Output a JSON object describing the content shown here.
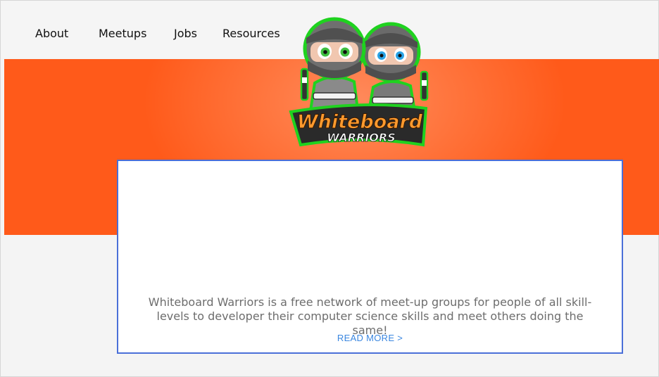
{
  "nav": {
    "items": [
      {
        "label": "About"
      },
      {
        "label": "Meetups"
      },
      {
        "label": "Jobs"
      },
      {
        "label": "Resources"
      }
    ]
  },
  "logo": {
    "line1": "Whiteboard",
    "line2": "WARRIORS",
    "colors": {
      "outline": "#1fd21f",
      "line1_fill": "#ff9a2e",
      "line2_fill": "#ffffff",
      "ninja_body": "#8a8a8a",
      "ninja_dark": "#5b5b5b"
    }
  },
  "hero": {
    "colors": {
      "edge": "#ff5a1a",
      "center": "#ff8a5c"
    }
  },
  "card": {
    "description": "Whiteboard Warriors is a free network of meet-up groups for people of all skill-levels to developer their computer science skills and meet others doing the same!",
    "read_more": "READ MORE >",
    "border_color": "#4a6fd8",
    "link_color": "#3b87e0"
  }
}
